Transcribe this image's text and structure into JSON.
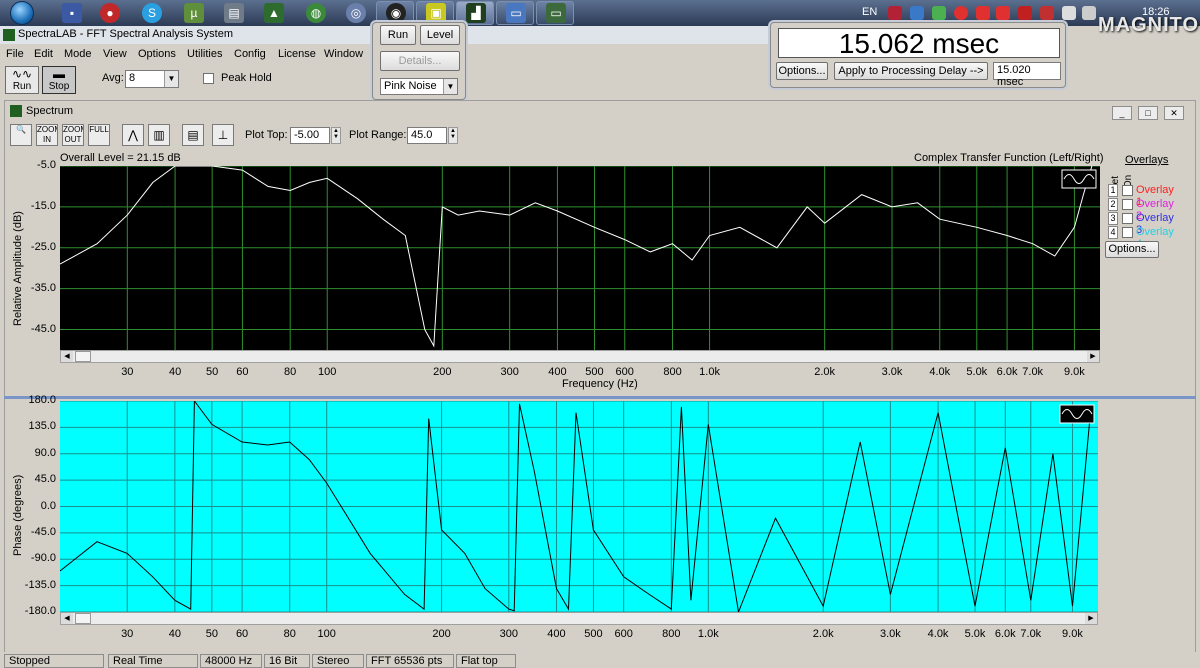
{
  "taskbar": {
    "language": "EN",
    "clock": "18:26",
    "watermark_logo": "MAGNITOLA"
  },
  "app": {
    "title": "SpectraLAB - FFT Spectral Analysis System",
    "menu": [
      "File",
      "Edit",
      "Mode",
      "View",
      "Options",
      "Utilities",
      "Config",
      "License",
      "Window"
    ]
  },
  "generator": {
    "run": "Run",
    "level": "Level",
    "details": "Details...",
    "signal": "Pink Noise"
  },
  "delay": {
    "value": "15.062 msec",
    "options": "Options...",
    "apply": "Apply to Processing Delay -->",
    "processing_delay": "15.020 msec"
  },
  "toolbar": {
    "run": "Run",
    "stop": "Stop",
    "avg_label": "Avg:",
    "avg_value": "8",
    "peak_hold": "Peak Hold"
  },
  "spectrum": {
    "window_title": "Spectrum",
    "tools": [
      "",
      "ZOOM IN",
      "ZOOM OUT",
      "FULL",
      "",
      "",
      "",
      ""
    ],
    "plot_top_label": "Plot Top:",
    "plot_top_value": "-5.00",
    "plot_range_label": "Plot Range:",
    "plot_range_value": "45.0",
    "overall_level": "Overall Level = 21.15 dB",
    "function": "Complex Transfer Function (Left/Right)",
    "overlays_title": "Overlays",
    "set_label": "Set",
    "on_label": "On",
    "overlays": [
      {
        "set": "1",
        "label": "Overlay 1",
        "color": "#ff2020"
      },
      {
        "set": "2",
        "label": "Overlay 2",
        "color": "#e020e0"
      },
      {
        "set": "3",
        "label": "Overlay 3",
        "color": "#3030e0"
      },
      {
        "set": "4",
        "label": "Overlay 4",
        "color": "#20d0e0"
      }
    ],
    "overlay_options": "Options...",
    "xlabel": "Frequency (Hz)"
  },
  "chart_data": [
    {
      "type": "line",
      "title": "Complex Transfer Function (Left/Right)",
      "xlabel": "Frequency (Hz)",
      "ylabel": "Relative Amplitude (dB)",
      "xscale": "log",
      "xlim": [
        20,
        10500
      ],
      "ylim": [
        -50,
        -5
      ],
      "yticks": [
        "-5.0",
        "-15.0",
        "-25.0",
        "-35.0",
        "-45.0"
      ],
      "xticks": [
        "30",
        "40",
        "50",
        "60",
        "80",
        "100",
        "200",
        "300",
        "400",
        "500",
        "600",
        "800",
        "1.0k",
        "2.0k",
        "3.0k",
        "4.0k",
        "5.0k",
        "6.0k",
        "7.0k",
        "9.0k"
      ],
      "background": "#000000",
      "line_color": "#ffffff",
      "grid_color": "#2f8f2f",
      "series": [
        {
          "x": [
            20,
            25,
            30,
            35,
            40,
            45,
            50,
            60,
            70,
            80,
            90,
            100,
            120,
            140,
            160,
            180,
            190,
            200,
            220,
            250,
            300,
            350,
            400,
            500,
            600,
            700,
            800,
            900,
            1000,
            1200,
            1500,
            1800,
            2000,
            2500,
            3000,
            3500,
            4000,
            5000,
            6000,
            7000,
            8000,
            9000,
            9500,
            10000
          ],
          "y": [
            -29,
            -24,
            -17,
            -9,
            -5,
            -5,
            -5,
            -6,
            -10,
            -11,
            -9,
            -8,
            -13,
            -18,
            -22,
            -45,
            -49,
            -15,
            -17,
            -16,
            -17,
            -14,
            -16,
            -20,
            -23,
            -26,
            -24,
            -28,
            -22,
            -20,
            -25,
            -15,
            -19,
            -12,
            -15,
            -14,
            -18,
            -20,
            -22,
            -24,
            -27,
            -20,
            -12,
            -5
          ]
        }
      ]
    },
    {
      "type": "line",
      "xlabel": "",
      "ylabel": "Phase (degrees)",
      "xscale": "log",
      "xlim": [
        20,
        10500
      ],
      "ylim": [
        -180,
        180
      ],
      "yticks": [
        "180.0",
        "135.0",
        "90.0",
        "45.0",
        "0.0",
        "-45.0",
        "-90.0",
        "-135.0",
        "-180.0"
      ],
      "xticks": [
        "30",
        "40",
        "50",
        "60",
        "80",
        "100",
        "200",
        "300",
        "400",
        "500",
        "600",
        "800",
        "1.0k",
        "2.0k",
        "3.0k",
        "4.0k",
        "5.0k",
        "6.0k",
        "7.0k",
        "9.0k"
      ],
      "background": "#00ffff",
      "line_color": "#000000",
      "grid_color": "#1a8f8f",
      "series": [
        {
          "x": [
            20,
            25,
            30,
            35,
            40,
            44,
            45,
            50,
            60,
            70,
            80,
            90,
            100,
            130,
            160,
            180,
            185,
            200,
            230,
            260,
            300,
            310,
            320,
            350,
            400,
            430,
            450,
            500,
            600,
            700,
            800,
            850,
            900,
            1000,
            1200,
            1500,
            2000,
            2500,
            3000,
            4000,
            5000,
            6000,
            7000,
            8000,
            9000,
            10000
          ],
          "y": [
            -110,
            -60,
            -80,
            -120,
            -160,
            -175,
            180,
            140,
            110,
            105,
            110,
            80,
            40,
            -80,
            -150,
            -175,
            150,
            -40,
            -80,
            -140,
            -175,
            -178,
            175,
            60,
            -140,
            -175,
            160,
            -40,
            -120,
            -150,
            -175,
            170,
            -160,
            140,
            -180,
            -20,
            -170,
            110,
            -150,
            160,
            -170,
            100,
            -160,
            90,
            -170,
            150
          ]
        }
      ]
    }
  ],
  "status": [
    "Stopped",
    "Real Time",
    "48000 Hz",
    "16 Bit",
    "Stereo",
    "FFT 65536 pts",
    "Flat top"
  ]
}
